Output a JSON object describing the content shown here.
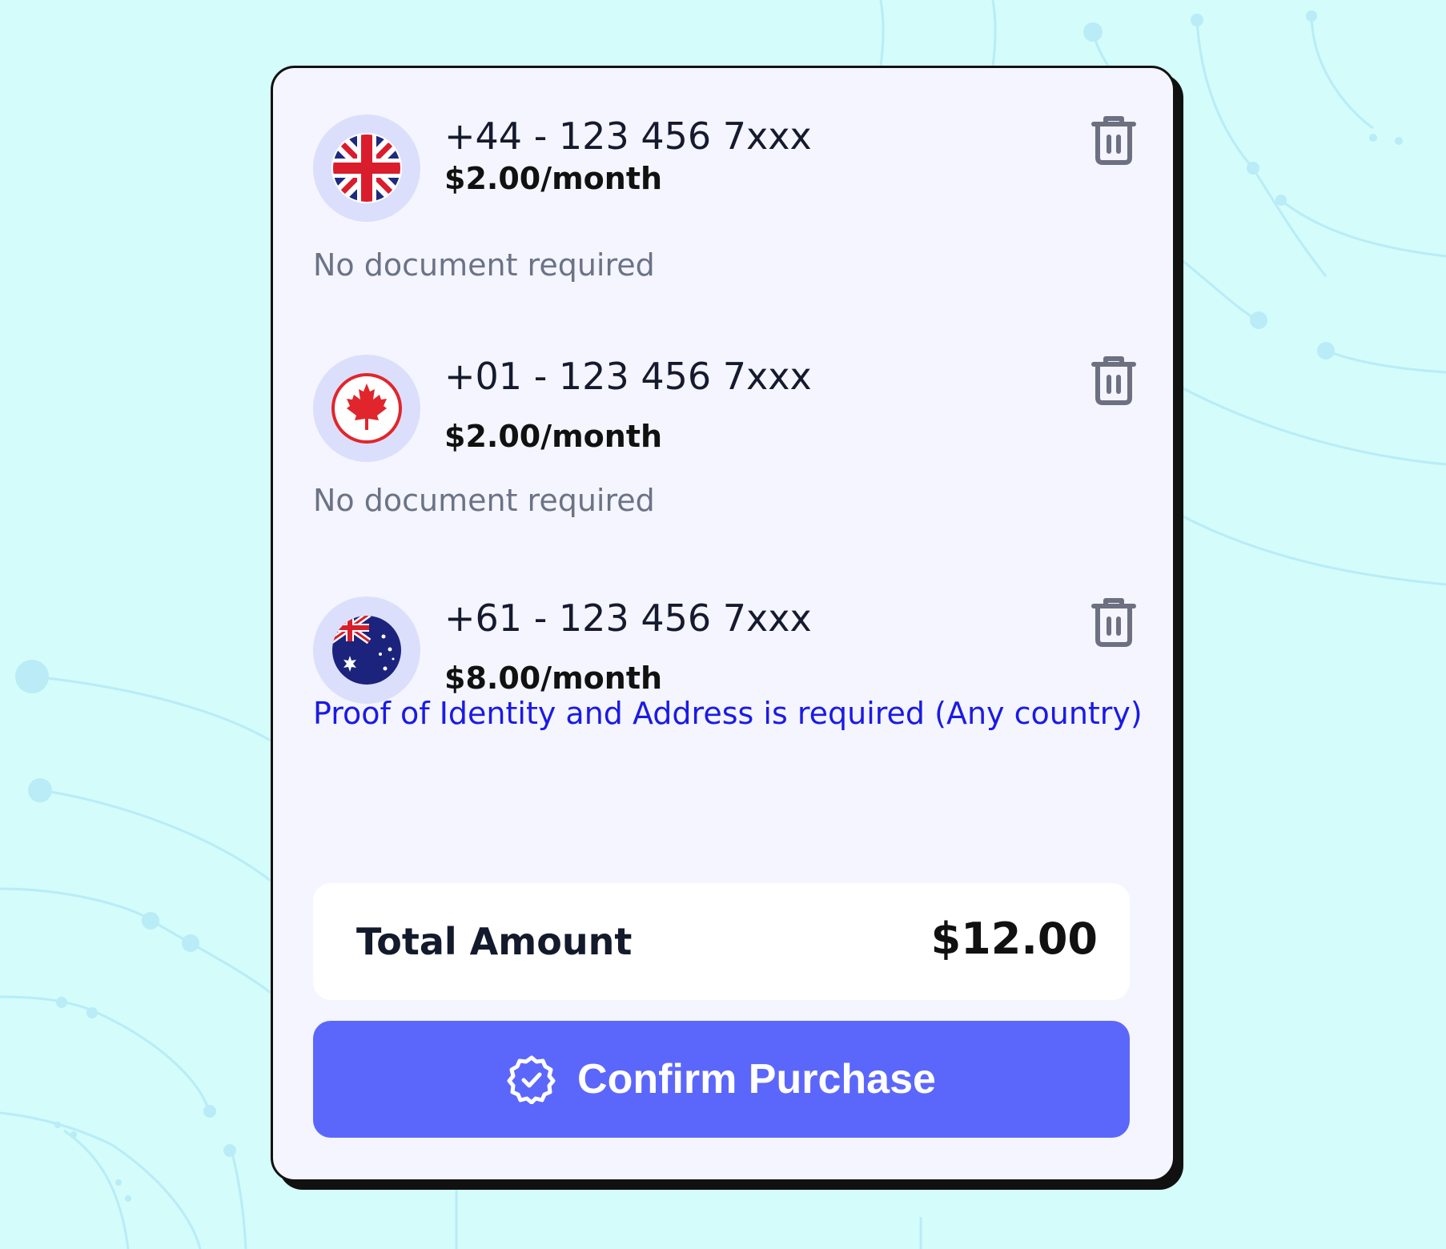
{
  "colors": {
    "background": "#d3fcfb",
    "card": "#f4f5fe",
    "accent": "#5b67fb",
    "required_text": "#1a1ae6",
    "muted_text": "#6b7385"
  },
  "numbers": [
    {
      "country_icon": "uk-flag-icon",
      "phone": "+44 - 123 456 7xxx",
      "price": "$2.00/month",
      "document_note": "No document required",
      "delete_icon": "trash-icon"
    },
    {
      "country_icon": "canada-flag-icon",
      "phone": "+01 - 123 456 7xxx",
      "price": "$2.00/month",
      "document_note": "No document required",
      "delete_icon": "trash-icon"
    },
    {
      "country_icon": "australia-flag-icon",
      "phone": "+61 - 123 456 7xxx",
      "price": "$8.00/month",
      "document_note": "Proof of Identity and Address is required (Any country)",
      "delete_icon": "trash-icon"
    }
  ],
  "summary": {
    "total_label": "Total Amount",
    "total_value": "$12.00"
  },
  "confirm": {
    "label": "Confirm Purchase",
    "icon": "verified-badge-icon"
  }
}
